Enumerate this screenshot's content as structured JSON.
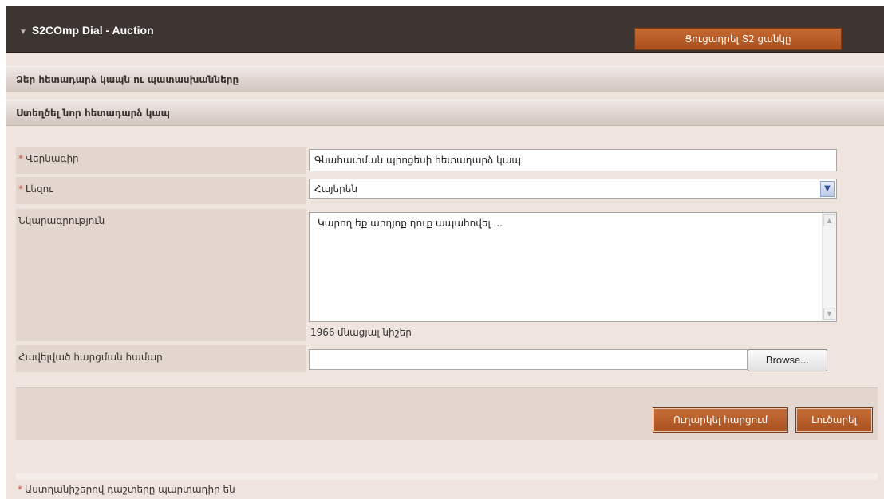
{
  "header": {
    "title": "S2COmp Dial - Auction",
    "list_button": "Ցուցադրել Տ2 ցանկը"
  },
  "sections": {
    "your_feedback": "Ձեր հետադարձ կապն ու պատասխանները",
    "create_new": "Ստեղծել նոր հետադարձ կապ"
  },
  "form": {
    "required_mark": "*",
    "title_label": "Վերնագիր",
    "title_value": "Գնահատման պրոցեսի հետադարձ կապ",
    "language_label": "Լեզու",
    "language_value": "Հայերեն",
    "description_label": "Նկարագրություն",
    "description_value": "Կարող եք արդյոք դուք ապահովել ...",
    "counter_number": "1966",
    "counter_text": "մնացյալ նիշեր",
    "attach_label": "Հավելված հարցման համար",
    "browse_label": "Browse..."
  },
  "actions": {
    "submit": "Ուղարկել հարցում",
    "clear": "Լուծարել"
  },
  "footnote": "Աստղանիշերով դաշտերը պարտադիր են",
  "colors": {
    "header_bg": "#3d3531",
    "accent": "#b35a26",
    "panel_bg": "#efe4de",
    "required": "#d0523a"
  }
}
